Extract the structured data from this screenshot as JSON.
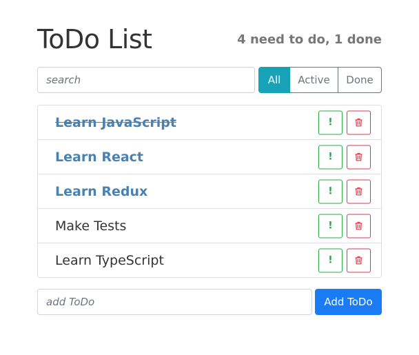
{
  "header": {
    "title": "ToDo List",
    "status": "4 need to do, 1 done"
  },
  "search": {
    "placeholder": "search",
    "value": ""
  },
  "filters": [
    {
      "label": "All",
      "active": true
    },
    {
      "label": "Active",
      "active": false
    },
    {
      "label": "Done",
      "active": false
    }
  ],
  "todos": [
    {
      "label": "Learn JavaScript",
      "important": true,
      "done": true
    },
    {
      "label": "Learn React",
      "important": true,
      "done": false
    },
    {
      "label": "Learn Redux",
      "important": true,
      "done": false
    },
    {
      "label": "Make Tests",
      "important": false,
      "done": false
    },
    {
      "label": "Learn TypeScript",
      "important": false,
      "done": false
    }
  ],
  "item_actions": {
    "important_icon": "exclamation-icon",
    "important_glyph": "!",
    "delete_icon": "trash-icon"
  },
  "add_form": {
    "placeholder": "add ToDo",
    "value": "",
    "button_label": "Add ToDo"
  },
  "colors": {
    "accent_filter": "#17a2b8",
    "important_text": "#4682b4",
    "important_button": "#28a745",
    "delete_button": "#dc3545",
    "primary_button": "#1a7cf5"
  }
}
